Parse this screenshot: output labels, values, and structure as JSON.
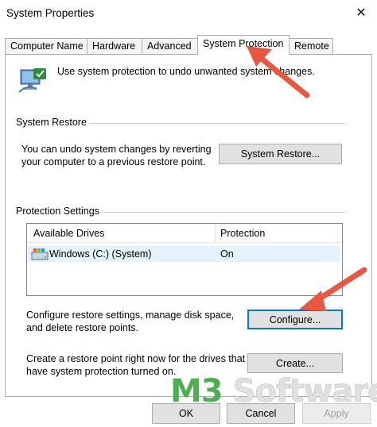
{
  "window": {
    "title": "System Properties",
    "close_glyph": "✕"
  },
  "tabs": [
    {
      "label": "Computer Name",
      "active": false
    },
    {
      "label": "Hardware",
      "active": false
    },
    {
      "label": "Advanced",
      "active": false
    },
    {
      "label": "System Protection",
      "active": true
    },
    {
      "label": "Remote",
      "active": false
    }
  ],
  "intro": {
    "text": "Use system protection to undo unwanted system changes.",
    "icon": "system-protection-computer-icon"
  },
  "system_restore": {
    "group_label": "System Restore",
    "description_line1": "You can undo system changes by reverting",
    "description_line2": "your computer to a previous restore point.",
    "button_label": "System Restore..."
  },
  "protection_settings": {
    "group_label": "Protection Settings",
    "columns": [
      "Available Drives",
      "Protection"
    ],
    "rows": [
      {
        "drive": "Windows (C:) (System)",
        "protection": "On",
        "icon": "drive-icon"
      }
    ],
    "configure_text_line1": "Configure restore settings, manage disk space,",
    "configure_text_line2": "and delete restore points.",
    "configure_button": "Configure...",
    "create_text_line1": "Create a restore point right now for the drives that",
    "create_text_line2": "have system protection turned on.",
    "create_button": "Create..."
  },
  "footer": {
    "ok": "OK",
    "cancel": "Cancel",
    "apply": "Apply"
  },
  "watermark": {
    "part1": "M3",
    "part2": " Software"
  },
  "colors": {
    "accent": "#0078d7",
    "arrow": "#e8573f",
    "selection": "#e5f1fb",
    "watermark_green": "#4caf50"
  }
}
